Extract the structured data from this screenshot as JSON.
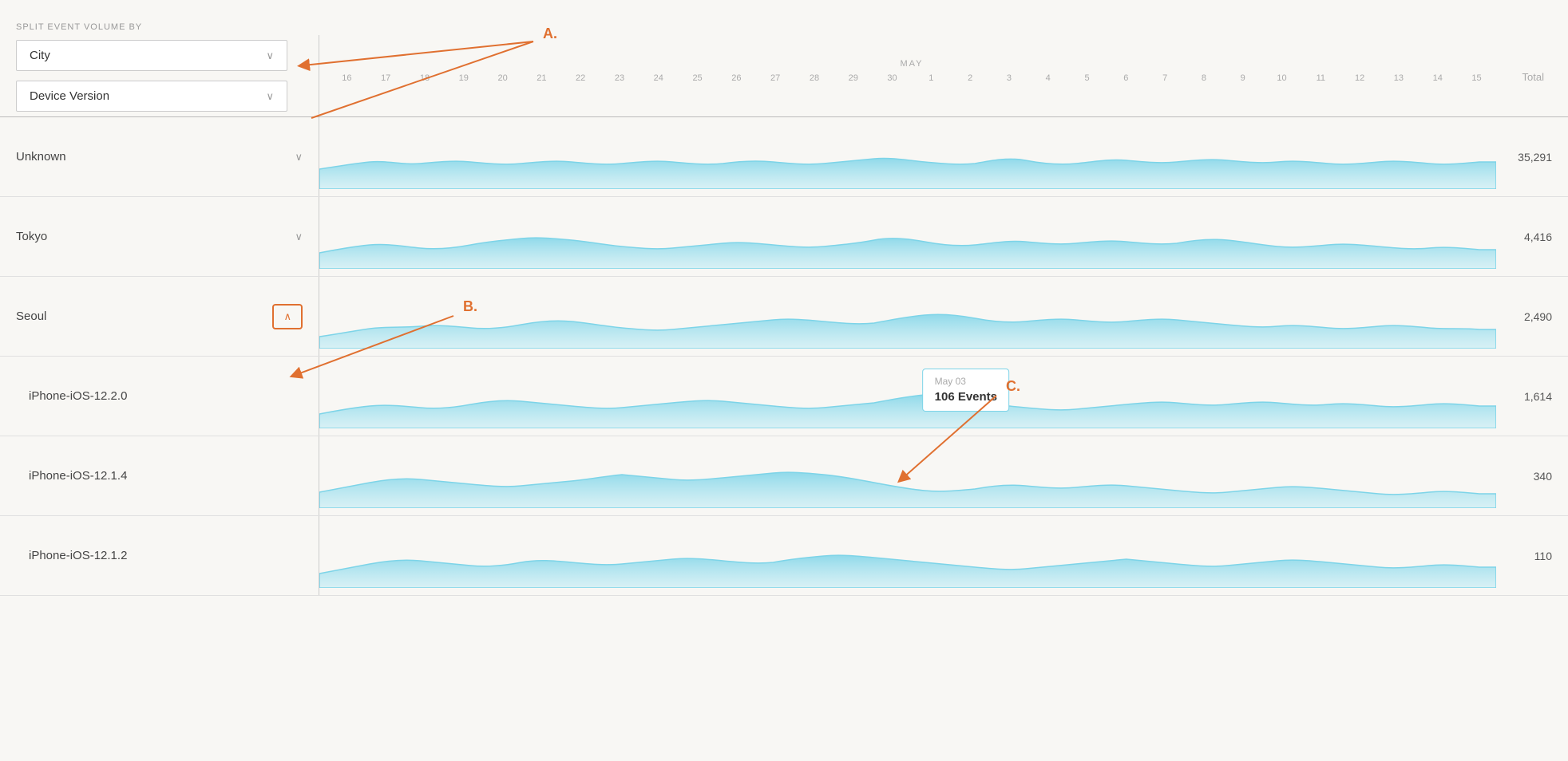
{
  "header": {
    "split_label": "SPLIT EVENT VOLUME BY",
    "dropdown1": {
      "label": "City",
      "id": "city-dropdown"
    },
    "dropdown2": {
      "label": "Device Version",
      "id": "device-dropdown"
    },
    "total_col": "Total"
  },
  "dates": {
    "april": [
      "16",
      "17",
      "18",
      "19",
      "20",
      "21",
      "22",
      "23",
      "24",
      "25",
      "26",
      "27",
      "28",
      "29",
      "30"
    ],
    "may_label": "MAY",
    "may": [
      "1",
      "2",
      "3",
      "4",
      "5",
      "6",
      "7",
      "8",
      "9",
      "10",
      "11",
      "12",
      "13",
      "14",
      "15"
    ]
  },
  "rows": [
    {
      "id": "unknown",
      "label": "Unknown",
      "total": "35,291",
      "chevron": "down",
      "chevron_box": false
    },
    {
      "id": "tokyo",
      "label": "Tokyo",
      "total": "4,416",
      "chevron": "down",
      "chevron_box": false
    },
    {
      "id": "seoul",
      "label": "Seoul",
      "total": "2,490",
      "chevron": "up",
      "chevron_box": true
    },
    {
      "id": "iphone-1220",
      "label": "iPhone-iOS-12.2.0",
      "total": "1,614",
      "chevron": null,
      "chevron_box": false,
      "sub": true
    },
    {
      "id": "iphone-1214",
      "label": "iPhone-iOS-12.1.4",
      "total": "340",
      "chevron": null,
      "chevron_box": false,
      "sub": true
    },
    {
      "id": "iphone-1212",
      "label": "iPhone-iOS-12.1.2",
      "total": "110",
      "chevron": null,
      "chevron_box": false,
      "sub": true
    }
  ],
  "tooltip": {
    "date": "May 03",
    "events": "106 Events"
  },
  "annotations": {
    "A": "A.",
    "B": "B.",
    "C": "C."
  }
}
